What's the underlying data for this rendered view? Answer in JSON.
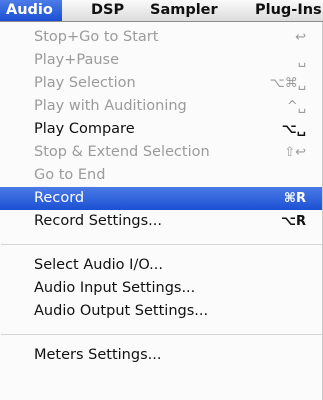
{
  "menubar": {
    "items": [
      "Audio",
      "DSP",
      "Sampler",
      "Plug-Ins"
    ]
  },
  "menu": {
    "items": [
      {
        "label": "Stop+Go to Start",
        "shortcut": "↩",
        "enabled": false
      },
      {
        "label": "Play+Pause",
        "shortcut": "␣",
        "enabled": false
      },
      {
        "label": "Play Selection",
        "shortcut": "⌥⌘␣",
        "enabled": false
      },
      {
        "label": "Play with Auditioning",
        "shortcut": "^␣",
        "enabled": false
      },
      {
        "label": "Play Compare",
        "shortcut": "⌥␣",
        "enabled": true
      },
      {
        "label": "Stop & Extend Selection",
        "shortcut": "⇧↩",
        "enabled": false
      },
      {
        "label": "Go to End",
        "shortcut": "",
        "enabled": false
      },
      {
        "label": "Record",
        "shortcut": "⌘R",
        "enabled": true,
        "highlighted": true
      },
      {
        "label": "Record Settings...",
        "shortcut": "⌥R",
        "enabled": true
      },
      {
        "label": "Select Audio I/O...",
        "shortcut": "",
        "enabled": true
      },
      {
        "label": "Audio Input Settings...",
        "shortcut": "",
        "enabled": true
      },
      {
        "label": "Audio Output Settings...",
        "shortcut": "",
        "enabled": true
      },
      {
        "label": "Meters Settings...",
        "shortcut": "",
        "enabled": true
      }
    ]
  },
  "colors": {
    "highlight": "#1c50d3",
    "disabled_text": "#9b9b9b"
  }
}
